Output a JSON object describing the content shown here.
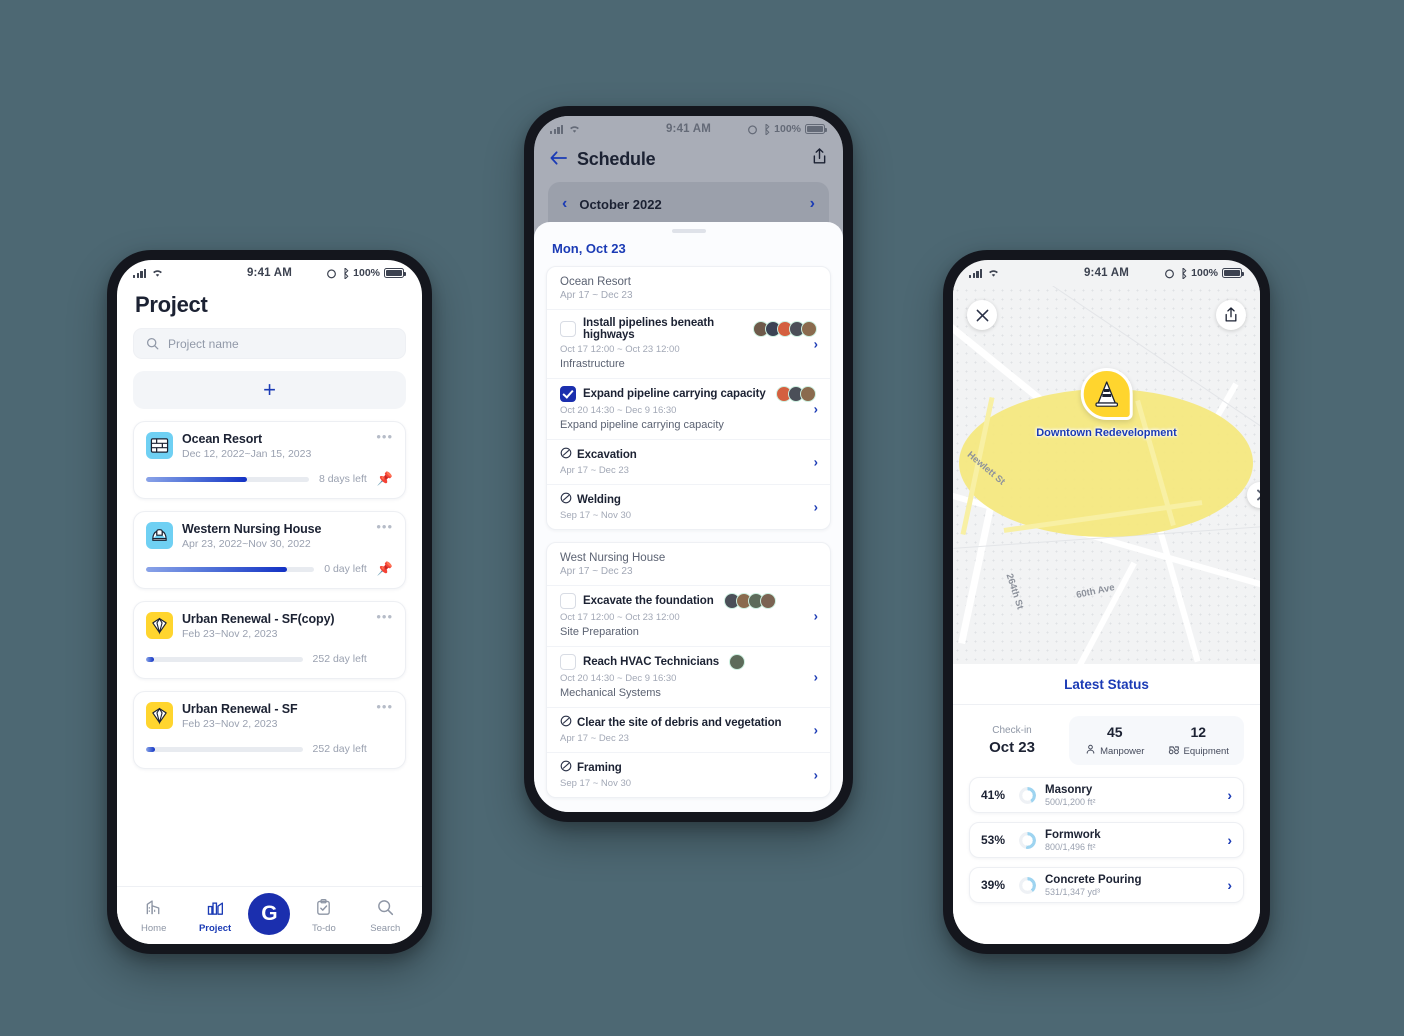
{
  "background_color": "#4d6873",
  "status_bar": {
    "time": "9:41 AM",
    "battery": "100%"
  },
  "project_screen": {
    "title": "Project",
    "search": {
      "placeholder": "Project name",
      "icon": "search-icon"
    },
    "add_button_label": "+",
    "projects": [
      {
        "name": "Ocean Resort",
        "dates": "Dec 12, 2022~Jan 15, 2023",
        "progress": 62,
        "days_left": "8 days left",
        "pinned": true,
        "icon": "brick-wall-icon",
        "icon_color": "#6fd0f3"
      },
      {
        "name": "Western Nursing House",
        "dates": "Apr 23, 2022~Nov 30, 2022",
        "progress": 84,
        "days_left": "0 day left",
        "pinned": true,
        "icon": "hard-hat-icon",
        "icon_color": "#6fd0f3"
      },
      {
        "name": "Urban Renewal - SF(copy)",
        "dates": "Feb 23~Nov 2, 2023",
        "progress": 5,
        "days_left": "252 day left",
        "pinned": false,
        "icon": "gem-icon",
        "icon_color": "#ffd52e"
      },
      {
        "name": "Urban Renewal - SF",
        "dates": "Feb 23~Nov 2, 2023",
        "progress": 6,
        "days_left": "252 day left",
        "pinned": false,
        "icon": "gem-icon",
        "icon_color": "#ffd52e"
      }
    ],
    "tabbar": [
      {
        "label": "Home",
        "icon": "building-icon",
        "active": false
      },
      {
        "label": "Project",
        "icon": "chart-building-icon",
        "active": true
      },
      {
        "label": "To-do",
        "icon": "clipboard-check-icon",
        "active": false
      },
      {
        "label": "Search",
        "icon": "search-icon",
        "active": false
      }
    ],
    "fab_label": "G"
  },
  "schedule_screen": {
    "title": "Schedule",
    "back_icon": "arrow-left-icon",
    "share_icon": "share-icon",
    "month": "October 2022",
    "prev_icon": "chevron-left-icon",
    "next_icon": "chevron-right-icon",
    "sheet_date": "Mon, Oct 23",
    "groups": [
      {
        "name": "Ocean Resort",
        "dates": "Apr 17 ~ Dec 23",
        "tasks": [
          {
            "type": "checkbox",
            "checked": false,
            "name": "Install pipelines beneath highways",
            "time": "Oct 17 12:00 ~ Oct 23 12:00",
            "sub": "Infrastructure",
            "avatars": 5
          },
          {
            "type": "checkbox",
            "checked": true,
            "name": "Expand pipeline carrying capacity",
            "time": "Oct 20 14:30 ~ Dec 9 16:30",
            "sub": "Expand pipeline carrying capacity",
            "avatars": 3
          },
          {
            "type": "milestone",
            "name": "Excavation",
            "time": "Apr 17 ~ Dec 23"
          },
          {
            "type": "milestone",
            "name": "Welding",
            "time": "Sep 17 ~ Nov 30"
          }
        ]
      },
      {
        "name": "West Nursing House",
        "dates": "Apr 17 ~ Dec 23",
        "tasks": [
          {
            "type": "checkbox",
            "checked": false,
            "name": "Excavate the foundation",
            "time": "Oct 17 12:00 ~ Oct 23 12:00",
            "sub": "Site Preparation",
            "avatars": 4
          },
          {
            "type": "checkbox",
            "checked": false,
            "name": "Reach HVAC Technicians",
            "time": "Oct 20 14:30 ~ Dec 9 16:30",
            "sub": "Mechanical Systems",
            "avatars": 1
          },
          {
            "type": "milestone",
            "name": "Clear the site of debris and vegetation",
            "time": "Apr 17 ~ Dec 23"
          },
          {
            "type": "milestone",
            "name": "Framing",
            "time": "Sep 17 ~ Nov 30"
          }
        ]
      }
    ]
  },
  "map_screen": {
    "close_icon": "close-icon",
    "share_icon": "share-icon",
    "side_arrow_icon": "chevron-right-icon",
    "marker_icon": "traffic-cone-icon",
    "marker_label": "Downtown Redevelopment",
    "zone_color": "#f4e87f",
    "roads": [
      "Hewlett St",
      "264th St",
      "60th Ave"
    ],
    "latest_status": {
      "title": "Latest Status",
      "checkin_label": "Check-in",
      "checkin_date": "Oct 23",
      "counts": [
        {
          "value": "45",
          "label": "Manpower",
          "icon": "person-icon"
        },
        {
          "value": "12",
          "label": "Equipment",
          "icon": "excavator-icon"
        }
      ],
      "items": [
        {
          "percent": "41%",
          "value": 41,
          "name": "Masonry",
          "qty": "500/1,200 ft²"
        },
        {
          "percent": "53%",
          "value": 53,
          "name": "Formwork",
          "qty": "800/1,496 ft²"
        },
        {
          "percent": "39%",
          "value": 39,
          "name": "Concrete Pouring",
          "qty": "531/1,347 yd³"
        }
      ],
      "arrow_icon": "chevron-right-icon",
      "ring_color": "#9ed4f0"
    }
  }
}
